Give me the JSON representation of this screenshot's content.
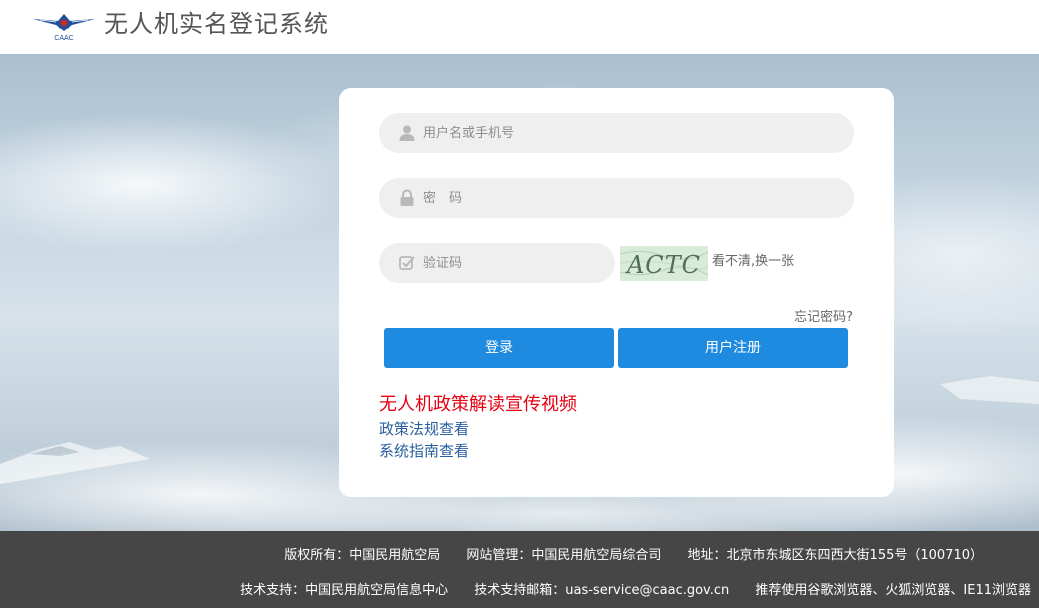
{
  "header": {
    "logo_text": "CAAC",
    "title": "无人机实名登记系统"
  },
  "login": {
    "username_placeholder": "用户名或手机号",
    "password_placeholder": "密　码",
    "captcha_placeholder": "验证码",
    "captcha_code": "ACTC",
    "refresh_captcha": "看不清,换一张",
    "forgot_password": "忘记密码?",
    "login_button": "登录",
    "register_button": "用户注册"
  },
  "links": {
    "policy_video": "无人机政策解读宣传视频",
    "regulations": "政策法规查看",
    "guide": "系统指南查看"
  },
  "footer": {
    "copyright": "版权所有：中国民用航空局",
    "site_admin": "网站管理：中国民用航空局综合司",
    "address": "地址：北京市东城区东四西大街155号（100710）",
    "tech_support": "技术支持：中国民用航空局信息中心",
    "support_email": "技术支持邮箱：uas-service@caac.gov.cn",
    "browser_tip": "推荐使用谷歌浏览器、火狐浏览器、IE11浏览器"
  },
  "colors": {
    "primary_button": "#1e8ae0",
    "video_link": "#e60012",
    "info_link": "#2a5f9e",
    "footer_bg": "#464646",
    "logo": "#1f4e9a"
  },
  "icons": {
    "username": "user-icon",
    "password": "lock-icon",
    "captcha": "check-icon"
  }
}
